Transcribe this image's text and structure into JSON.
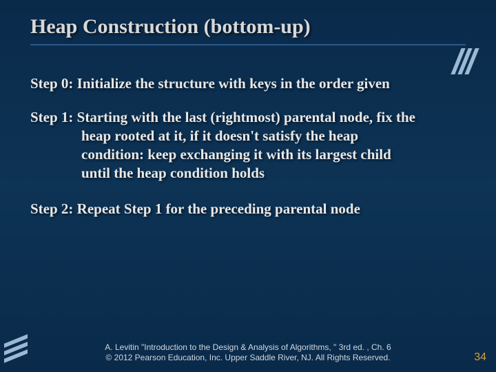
{
  "title": "Heap Construction (bottom-up)",
  "steps": {
    "s0": "Step 0: Initialize the structure with keys in the order given",
    "s1_line1": "Step 1: Starting with the last (rightmost) parental node, fix the",
    "s1_line2": "heap rooted at it, if it doesn't satisfy the heap",
    "s1_line3": "condition: keep exchanging  it with its largest child",
    "s1_line4": "until the heap condition holds",
    "s2": "Step 2: Repeat Step 1 for the preceding parental node"
  },
  "footer": {
    "line1": "A. Levitin \"Introduction to the Design & Analysis of Algorithms, \" 3rd ed. , Ch. 6",
    "line2": "© 2012 Pearson Education, Inc. Upper Saddle River, NJ. All Rights Reserved."
  },
  "page_number": "34"
}
